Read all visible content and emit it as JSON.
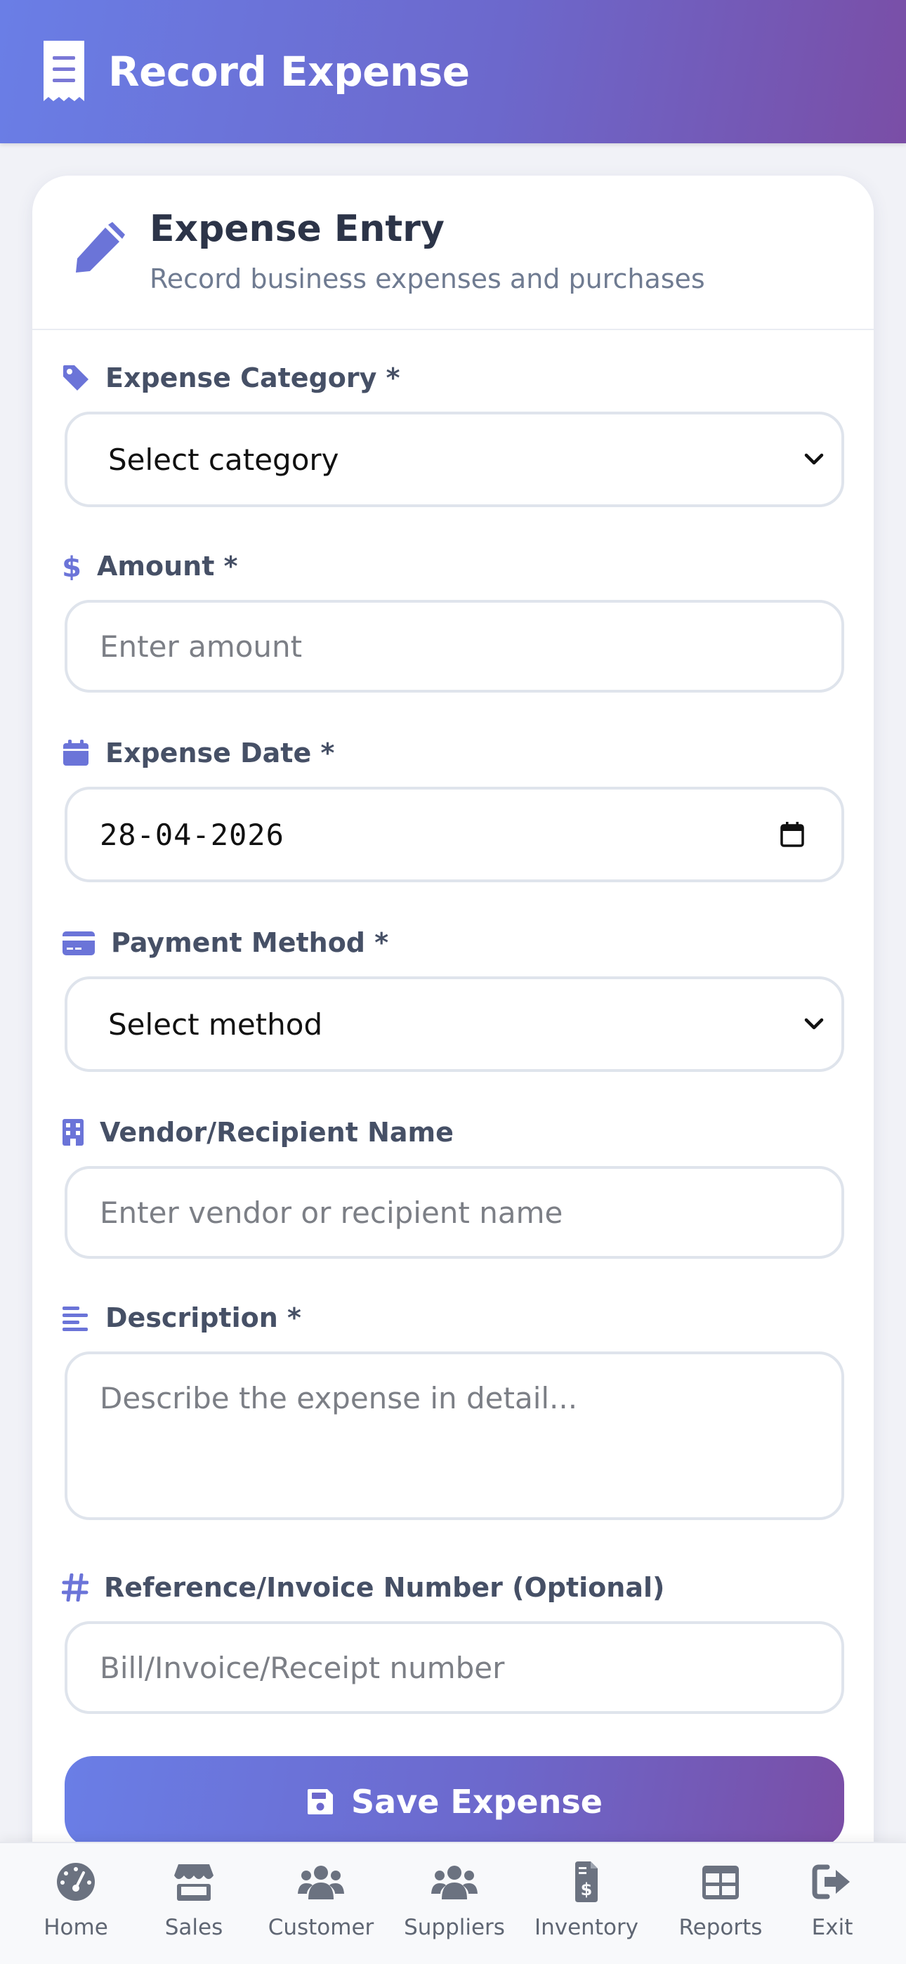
{
  "header": {
    "title": "Record Expense",
    "icon": "receipt-icon"
  },
  "card": {
    "title": "Expense Entry",
    "subtitle": "Record business expenses and purchases",
    "icon": "pen-icon"
  },
  "form": {
    "category": {
      "label": "Expense Category *",
      "value": "Select category",
      "icon": "tag-icon"
    },
    "amount": {
      "label": "Amount *",
      "placeholder": "Enter amount",
      "icon": "dollar-icon"
    },
    "date": {
      "label": "Expense Date *",
      "value": "28-04-2026",
      "icon": "calendar-icon"
    },
    "payment": {
      "label": "Payment Method *",
      "value": "Select method",
      "icon": "credit-card-icon"
    },
    "vendor": {
      "label": "Vendor/Recipient Name",
      "placeholder": "Enter vendor or recipient name",
      "icon": "building-icon"
    },
    "description": {
      "label": "Description *",
      "placeholder": "Describe the expense in detail...",
      "icon": "align-left-icon"
    },
    "reference": {
      "label": "Reference/Invoice Number (Optional)",
      "placeholder": "Bill/Invoice/Receipt number",
      "icon": "hashtag-icon"
    },
    "save_label": "Save Expense"
  },
  "nav": {
    "items": [
      {
        "label": "Home",
        "icon": "dashboard-icon"
      },
      {
        "label": "Sales",
        "icon": "store-icon"
      },
      {
        "label": "Customer",
        "icon": "users-icon"
      },
      {
        "label": "Suppliers",
        "icon": "users-icon"
      },
      {
        "label": "Inventory",
        "icon": "invoice-dollar-icon"
      },
      {
        "label": "Reports",
        "icon": "table-icon"
      },
      {
        "label": "Exit",
        "icon": "sign-out-icon"
      }
    ]
  },
  "colors": {
    "accent": "#6b74d8",
    "header_start": "#6a7ee6",
    "header_end": "#7a4ea6",
    "label_text": "#465066",
    "nav_icon": "#6b7280"
  }
}
